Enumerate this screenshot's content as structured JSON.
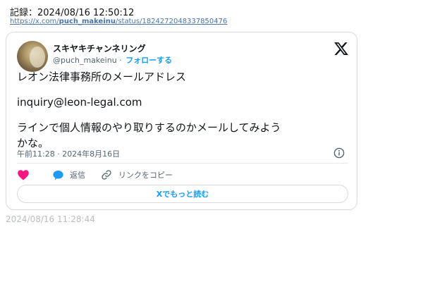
{
  "record": {
    "label": "記録：2024/08/16 12:50:12",
    "url_prefix": "https://x.com/",
    "url_user": "puch_makeinu",
    "url_suffix": "/status/1824272048337850476"
  },
  "tweet": {
    "display_name": "スキヤキチャンネリング",
    "handle": "@puch_makeinu",
    "separator": " · ",
    "follow_label": "フォローする",
    "text_lines": [
      "レオン法律事務所のメールアドレス",
      "inquiry@leon-legal.com",
      "ラインで個人情報のやり取りするのかメールしてみよう",
      "かな。"
    ],
    "timestamp": "午前11:28 · 2024年8月16日",
    "reply_label": "返信",
    "copy_link_label": "リンクをコピー",
    "read_more_label": "Xでもっと読む"
  },
  "footer": {
    "timestamp": "2024/08/16 11:28:44"
  },
  "colors": {
    "accent": "#1d9bf0",
    "heart": "#f91880",
    "muted": "#536471",
    "border": "#d6dbe0"
  },
  "icons": [
    "x-logo-icon",
    "info-icon",
    "heart-icon",
    "reply-bubble-icon",
    "link-icon"
  ]
}
